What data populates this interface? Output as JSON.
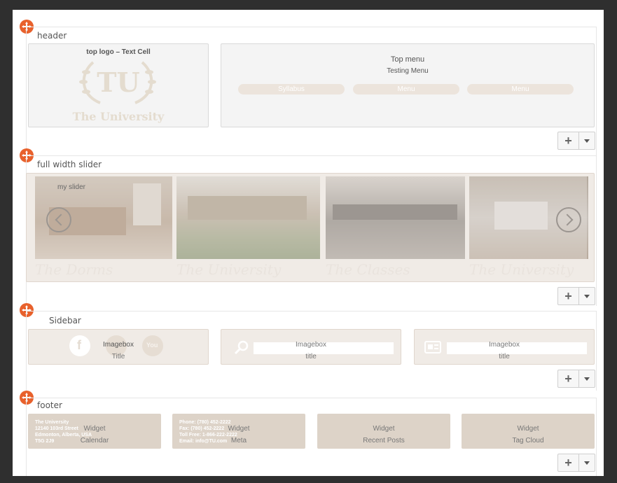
{
  "sections": {
    "header": {
      "title": "header"
    },
    "slider": {
      "title": "full width slider"
    },
    "sidebar": {
      "title": "Sidebar"
    },
    "footer": {
      "title": "footer"
    }
  },
  "header": {
    "logo_cell_label": "top logo – Text Cell",
    "logo_monogram": "TU",
    "logo_wordmark": "The University",
    "menu_cell_label": "Top menu",
    "menu_name": "Testing Menu",
    "menu_items": [
      "Syllabus",
      "Menu",
      "Menu"
    ]
  },
  "slider": {
    "label": "my slider",
    "captions": [
      "The Dorms",
      "The University",
      "The Classes",
      "The University"
    ]
  },
  "sidebar": {
    "boxes": [
      {
        "type": "Imagebox",
        "title": "Title"
      },
      {
        "type": "Imagebox",
        "title": "title"
      },
      {
        "type": "Imagebox",
        "title": "title"
      }
    ]
  },
  "footer": {
    "widgets": [
      {
        "type": "Widget",
        "name": "Calendar"
      },
      {
        "type": "Widget",
        "name": "Meta"
      },
      {
        "type": "Widget",
        "name": "Recent Posts"
      },
      {
        "type": "Widget",
        "name": "Tag Cloud"
      }
    ],
    "address_lines": [
      "The University",
      "12140 103rd Street",
      "Edmonton, Alberta, USA",
      "T5G 2J9"
    ],
    "contact_lines": [
      "Phone: (780) 452-2222",
      "Fax: (780) 452-2222",
      "Toll Free: 1-866-222-2222",
      "Email: info@TU.com"
    ]
  },
  "colors": {
    "accent": "#e8612c",
    "tan": "#ddd3c8",
    "panel": "#f4f4f4"
  },
  "icons": {
    "move": "move-icon",
    "add": "plus-icon",
    "menu": "caret-down-icon"
  }
}
